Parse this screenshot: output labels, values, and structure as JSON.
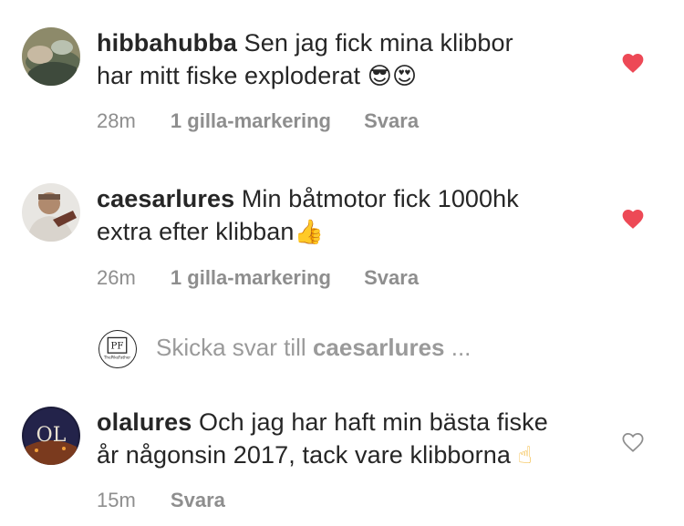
{
  "comments": [
    {
      "username": "hibbahubba",
      "text": "Sen jag fick mina klibbor",
      "text_line2": "har mitt fiske exploderat",
      "emojis": "😎😍",
      "time": "28m",
      "likes": "1 gilla-markering",
      "reply": "Svara",
      "liked": true
    },
    {
      "username": "caesarlures",
      "text": "Min båtmotor fick 1000hk",
      "text_line2": "extra efter klibban",
      "emojis": "👍",
      "time": "26m",
      "likes": "1 gilla-markering",
      "reply": "Svara",
      "liked": true
    },
    {
      "username": "olalures",
      "text": "Och jag har haft min bästa fiske",
      "text_line2": "år någonsin 2017, tack vare klibborna",
      "emojis": "☝",
      "time": "15m",
      "reply": "Svara",
      "liked": false
    }
  ],
  "reply_prompt": {
    "prefix": "Skicka svar till",
    "username": "caesarlures",
    "suffix": "...",
    "avatar_label": "PF",
    "avatar_caption": "ThePikeFather"
  },
  "colors": {
    "heart_filled": "#ed4956",
    "heart_outline": "#8e8e8e",
    "meta_text": "#8e8e8e",
    "main_text": "#262626"
  }
}
